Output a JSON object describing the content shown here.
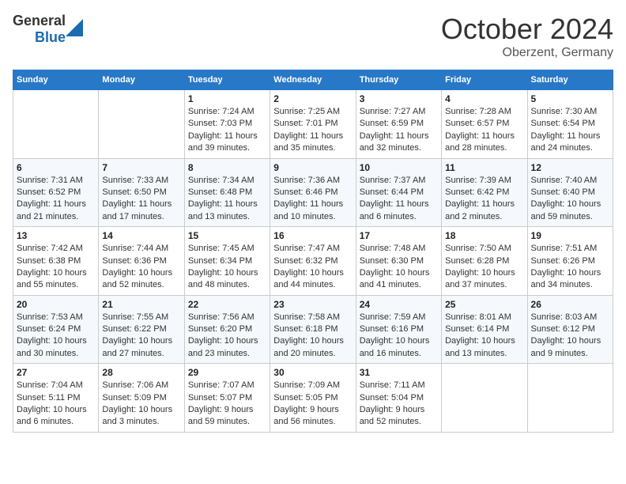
{
  "header": {
    "logo_general": "General",
    "logo_blue": "Blue",
    "month_title": "October 2024",
    "location": "Oberzent, Germany"
  },
  "days_of_week": [
    "Sunday",
    "Monday",
    "Tuesday",
    "Wednesday",
    "Thursday",
    "Friday",
    "Saturday"
  ],
  "weeks": [
    [
      {
        "day": "",
        "info": ""
      },
      {
        "day": "",
        "info": ""
      },
      {
        "day": "1",
        "info": "Sunrise: 7:24 AM\nSunset: 7:03 PM\nDaylight: 11 hours and 39 minutes."
      },
      {
        "day": "2",
        "info": "Sunrise: 7:25 AM\nSunset: 7:01 PM\nDaylight: 11 hours and 35 minutes."
      },
      {
        "day": "3",
        "info": "Sunrise: 7:27 AM\nSunset: 6:59 PM\nDaylight: 11 hours and 32 minutes."
      },
      {
        "day": "4",
        "info": "Sunrise: 7:28 AM\nSunset: 6:57 PM\nDaylight: 11 hours and 28 minutes."
      },
      {
        "day": "5",
        "info": "Sunrise: 7:30 AM\nSunset: 6:54 PM\nDaylight: 11 hours and 24 minutes."
      }
    ],
    [
      {
        "day": "6",
        "info": "Sunrise: 7:31 AM\nSunset: 6:52 PM\nDaylight: 11 hours and 21 minutes."
      },
      {
        "day": "7",
        "info": "Sunrise: 7:33 AM\nSunset: 6:50 PM\nDaylight: 11 hours and 17 minutes."
      },
      {
        "day": "8",
        "info": "Sunrise: 7:34 AM\nSunset: 6:48 PM\nDaylight: 11 hours and 13 minutes."
      },
      {
        "day": "9",
        "info": "Sunrise: 7:36 AM\nSunset: 6:46 PM\nDaylight: 11 hours and 10 minutes."
      },
      {
        "day": "10",
        "info": "Sunrise: 7:37 AM\nSunset: 6:44 PM\nDaylight: 11 hours and 6 minutes."
      },
      {
        "day": "11",
        "info": "Sunrise: 7:39 AM\nSunset: 6:42 PM\nDaylight: 11 hours and 2 minutes."
      },
      {
        "day": "12",
        "info": "Sunrise: 7:40 AM\nSunset: 6:40 PM\nDaylight: 10 hours and 59 minutes."
      }
    ],
    [
      {
        "day": "13",
        "info": "Sunrise: 7:42 AM\nSunset: 6:38 PM\nDaylight: 10 hours and 55 minutes."
      },
      {
        "day": "14",
        "info": "Sunrise: 7:44 AM\nSunset: 6:36 PM\nDaylight: 10 hours and 52 minutes."
      },
      {
        "day": "15",
        "info": "Sunrise: 7:45 AM\nSunset: 6:34 PM\nDaylight: 10 hours and 48 minutes."
      },
      {
        "day": "16",
        "info": "Sunrise: 7:47 AM\nSunset: 6:32 PM\nDaylight: 10 hours and 44 minutes."
      },
      {
        "day": "17",
        "info": "Sunrise: 7:48 AM\nSunset: 6:30 PM\nDaylight: 10 hours and 41 minutes."
      },
      {
        "day": "18",
        "info": "Sunrise: 7:50 AM\nSunset: 6:28 PM\nDaylight: 10 hours and 37 minutes."
      },
      {
        "day": "19",
        "info": "Sunrise: 7:51 AM\nSunset: 6:26 PM\nDaylight: 10 hours and 34 minutes."
      }
    ],
    [
      {
        "day": "20",
        "info": "Sunrise: 7:53 AM\nSunset: 6:24 PM\nDaylight: 10 hours and 30 minutes."
      },
      {
        "day": "21",
        "info": "Sunrise: 7:55 AM\nSunset: 6:22 PM\nDaylight: 10 hours and 27 minutes."
      },
      {
        "day": "22",
        "info": "Sunrise: 7:56 AM\nSunset: 6:20 PM\nDaylight: 10 hours and 23 minutes."
      },
      {
        "day": "23",
        "info": "Sunrise: 7:58 AM\nSunset: 6:18 PM\nDaylight: 10 hours and 20 minutes."
      },
      {
        "day": "24",
        "info": "Sunrise: 7:59 AM\nSunset: 6:16 PM\nDaylight: 10 hours and 16 minutes."
      },
      {
        "day": "25",
        "info": "Sunrise: 8:01 AM\nSunset: 6:14 PM\nDaylight: 10 hours and 13 minutes."
      },
      {
        "day": "26",
        "info": "Sunrise: 8:03 AM\nSunset: 6:12 PM\nDaylight: 10 hours and 9 minutes."
      }
    ],
    [
      {
        "day": "27",
        "info": "Sunrise: 7:04 AM\nSunset: 5:11 PM\nDaylight: 10 hours and 6 minutes."
      },
      {
        "day": "28",
        "info": "Sunrise: 7:06 AM\nSunset: 5:09 PM\nDaylight: 10 hours and 3 minutes."
      },
      {
        "day": "29",
        "info": "Sunrise: 7:07 AM\nSunset: 5:07 PM\nDaylight: 9 hours and 59 minutes."
      },
      {
        "day": "30",
        "info": "Sunrise: 7:09 AM\nSunset: 5:05 PM\nDaylight: 9 hours and 56 minutes."
      },
      {
        "day": "31",
        "info": "Sunrise: 7:11 AM\nSunset: 5:04 PM\nDaylight: 9 hours and 52 minutes."
      },
      {
        "day": "",
        "info": ""
      },
      {
        "day": "",
        "info": ""
      }
    ]
  ]
}
